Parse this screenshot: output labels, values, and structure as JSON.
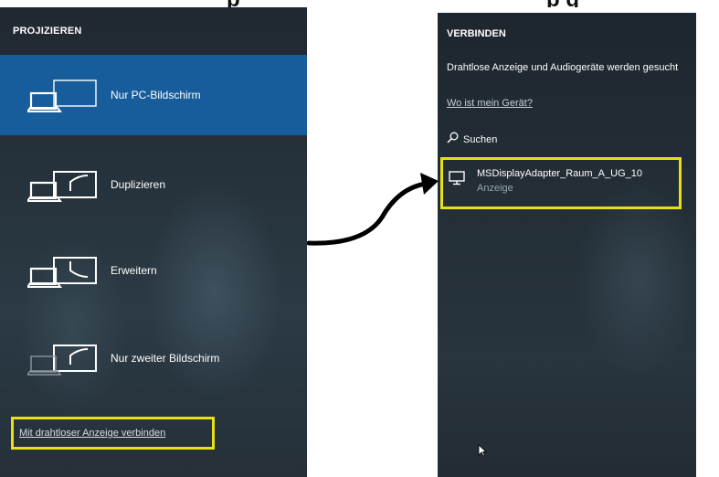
{
  "project_panel": {
    "title": "PROJIZIEREN",
    "items": [
      {
        "label": "Nur PC-Bildschirm",
        "selected": true,
        "icon": "pc-screen-only-icon"
      },
      {
        "label": "Duplizieren",
        "selected": false,
        "icon": "duplicate-icon"
      },
      {
        "label": "Erweitern",
        "selected": false,
        "icon": "extend-icon"
      },
      {
        "label": "Nur zweiter Bildschirm",
        "selected": false,
        "icon": "second-screen-only-icon"
      }
    ],
    "wireless_link": "Mit drahtloser Anzeige verbinden"
  },
  "connect_panel": {
    "title": "VERBINDEN",
    "status": "Drahtlose Anzeige und Audiogeräte werden gesucht",
    "help_link": "Wo ist mein Gerät?",
    "search_label": "Suchen",
    "device": {
      "name": "MSDisplayAdapter_Raum_A_UG_10",
      "type": "Anzeige",
      "icon": "monitor-icon"
    }
  },
  "colors": {
    "highlight": "#e8df17",
    "selected_item": "#175c9b",
    "panel_bg": "#222c34",
    "text": "#ffffff"
  }
}
